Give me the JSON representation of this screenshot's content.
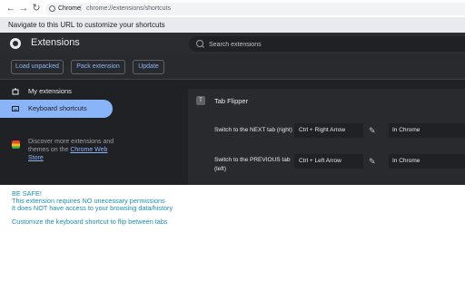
{
  "address_bar": {
    "back_icon": "←",
    "forward_icon": "→",
    "reload_icon": "↻",
    "site_label": "Chrome",
    "separator": "|",
    "url": "chrome://extensions/shortcuts"
  },
  "tip": {
    "text": "Navigate to this URL to customize your shortcuts"
  },
  "header": {
    "title": "Extensions",
    "search_placeholder": "Search extensions"
  },
  "toolbar": {
    "load_unpacked": "Load unpacked",
    "pack_extension": "Pack extension",
    "update": "Update"
  },
  "sidebar": {
    "items": [
      {
        "label": "My extensions",
        "icon": "extensions-icon",
        "active": false
      },
      {
        "label": "Keyboard shortcuts",
        "icon": "keyboard-icon",
        "active": true
      }
    ],
    "store_text": "Discover more extensions and themes on the",
    "store_link": "Chrome Web Store"
  },
  "card": {
    "badge": "T",
    "extension_name": "Tab Flipper",
    "rows": [
      {
        "label": "Switch to the NEXT tab (right)",
        "shortcut": "Ctrl + Right Arrow",
        "scope": "In Chrome"
      },
      {
        "label": "Switch to the PREVIOUS tab (left)",
        "shortcut": "Ctrl + Left Arrow",
        "scope": "In Chrome"
      }
    ]
  },
  "notes": {
    "line1": "BE SAFE!",
    "line2": "This extension requires NO unecessary permissions",
    "line3": "It does NOT have access to your browsing data/history",
    "line4": "Customize the keyboard shortcut to flip between tabs"
  },
  "colors": {
    "accent": "#8ab4f8",
    "note_text": "#1a8fb8",
    "dark_bg": "#202124"
  }
}
